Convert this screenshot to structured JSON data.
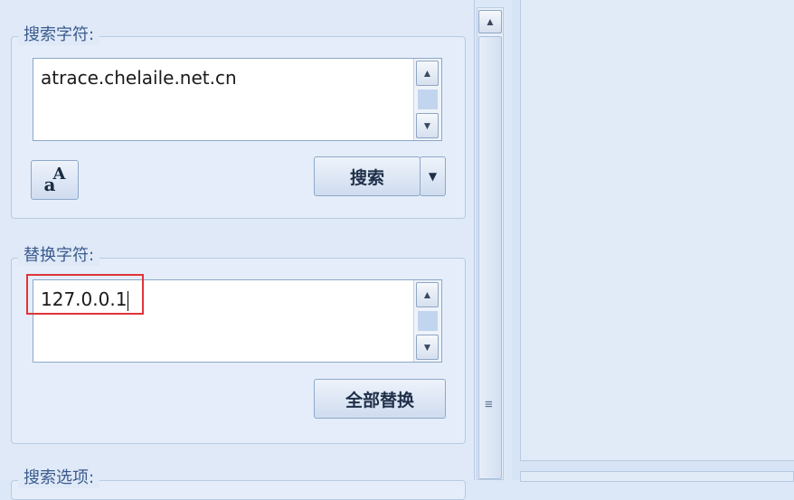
{
  "search_group": {
    "title": "搜索字符:",
    "value": "atrace.chelaile.net.cn",
    "font_icon_label": "A",
    "font_icon_small": "a",
    "search_button_label": "搜索",
    "dropdown_arrow": "▼"
  },
  "replace_group": {
    "title": "替换字符:",
    "value": "127.0.0.1",
    "replace_all_label": "全部替换"
  },
  "options_group": {
    "title": "搜索选项:"
  },
  "scrollbar": {
    "up_arrow": "▲",
    "down_arrow": "▼",
    "grip": "≡"
  },
  "colors": {
    "highlight": "#e0343a",
    "panel_bg": "#dfe9f8"
  }
}
